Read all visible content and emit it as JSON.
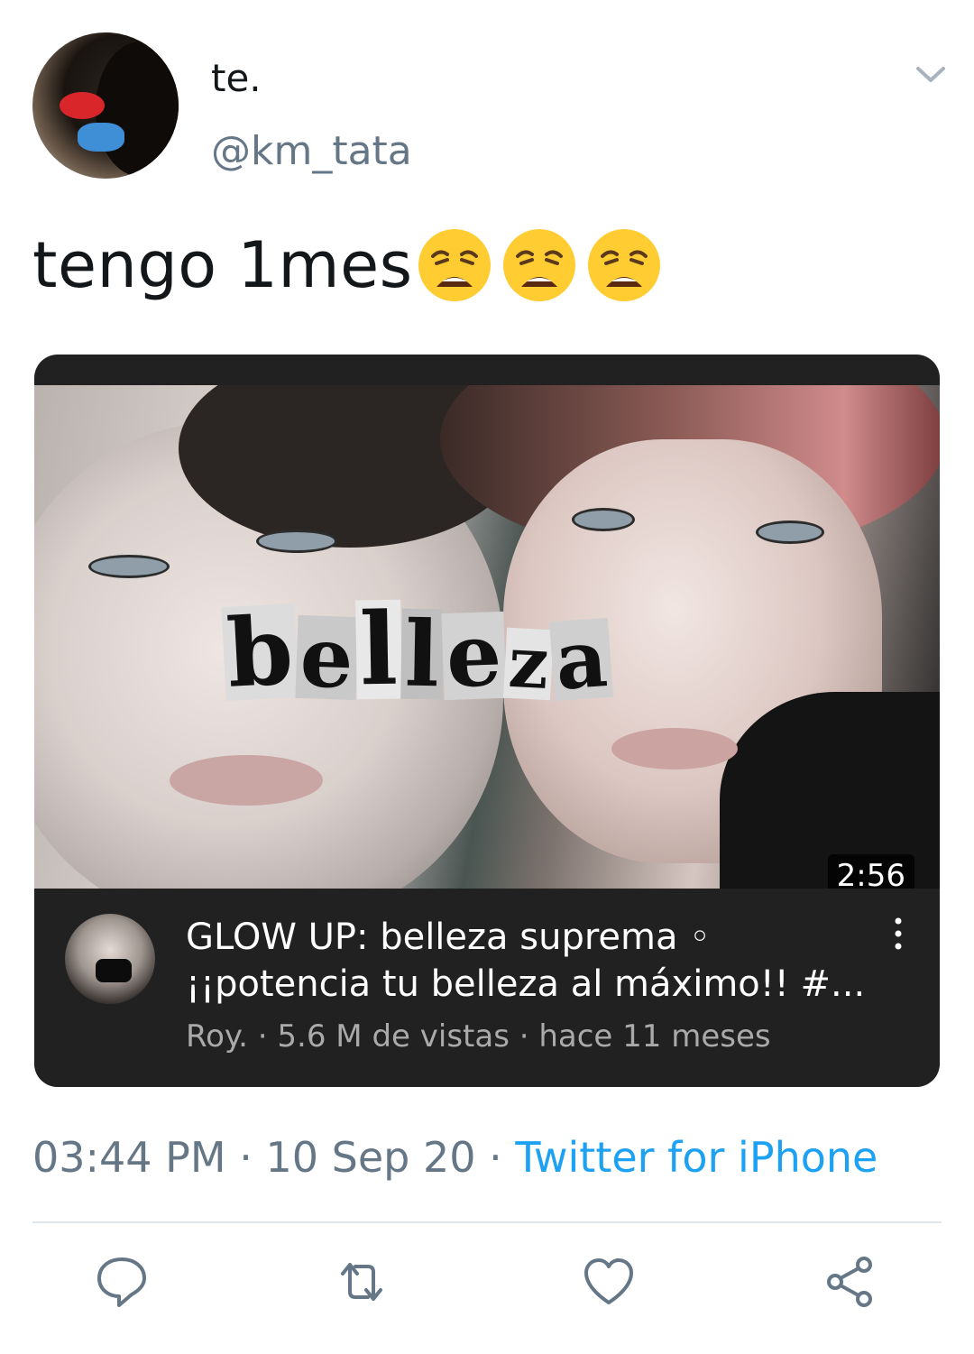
{
  "user": {
    "display_name": "te.",
    "handle": "@km_tata"
  },
  "tweet": {
    "text": "tengo 1mes",
    "emojis": [
      "weary-face",
      "weary-face",
      "weary-face"
    ]
  },
  "video_card": {
    "thumbnail_text": [
      "b",
      "e",
      "l",
      "l",
      "e",
      "z",
      "a"
    ],
    "duration": "2:56",
    "title": "GLOW UP: belleza suprema ◦ ¡¡potencia tu belleza al máximo!! #...",
    "channel": "Roy.",
    "views": "5.6 M de vistas",
    "age": "hace 11 meses"
  },
  "meta": {
    "time": "03:44 PM",
    "date": "10 Sep 20",
    "separator": " · ",
    "source": "Twitter for iPhone"
  },
  "actions": [
    "reply-icon",
    "retweet-icon",
    "like-icon",
    "share-icon"
  ],
  "colors": {
    "accent": "#1da1f2",
    "secondary_text": "#657786",
    "card_bg": "#212121"
  }
}
